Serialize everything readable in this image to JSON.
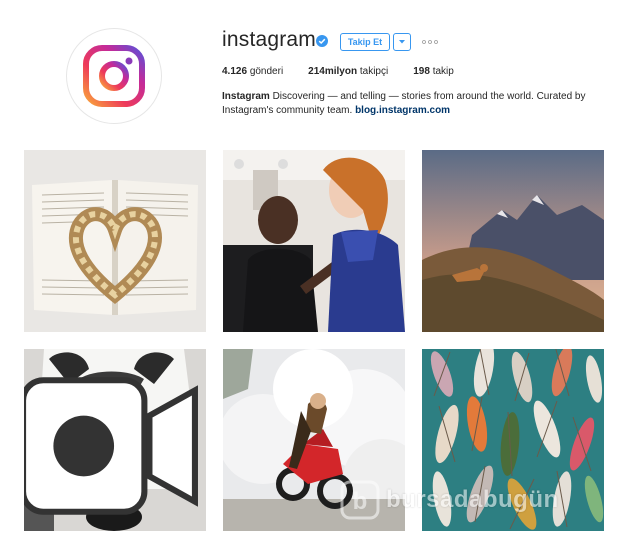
{
  "profile": {
    "username": "instagram",
    "verified": true,
    "follow_label": "Takip Et",
    "stats": {
      "posts_value": "4.126",
      "posts_label": "gönderi",
      "followers_value": "214milyon",
      "followers_label": "takipçi",
      "following_value": "198",
      "following_label": "takip"
    },
    "bio": {
      "name": "Instagram",
      "text": " Discovering — and telling — stories from around the world. Curated by Instagram's community team. ",
      "link": "blog.instagram.com"
    }
  },
  "colors": {
    "accent": "#3897f0",
    "link": "#003569"
  },
  "icons": {
    "verified": "verified-badge-icon",
    "dropdown": "chevron-down-icon",
    "more": "more-options-icon",
    "video": "video-camera-icon"
  },
  "watermark": {
    "text": "bursadabugün"
  }
}
